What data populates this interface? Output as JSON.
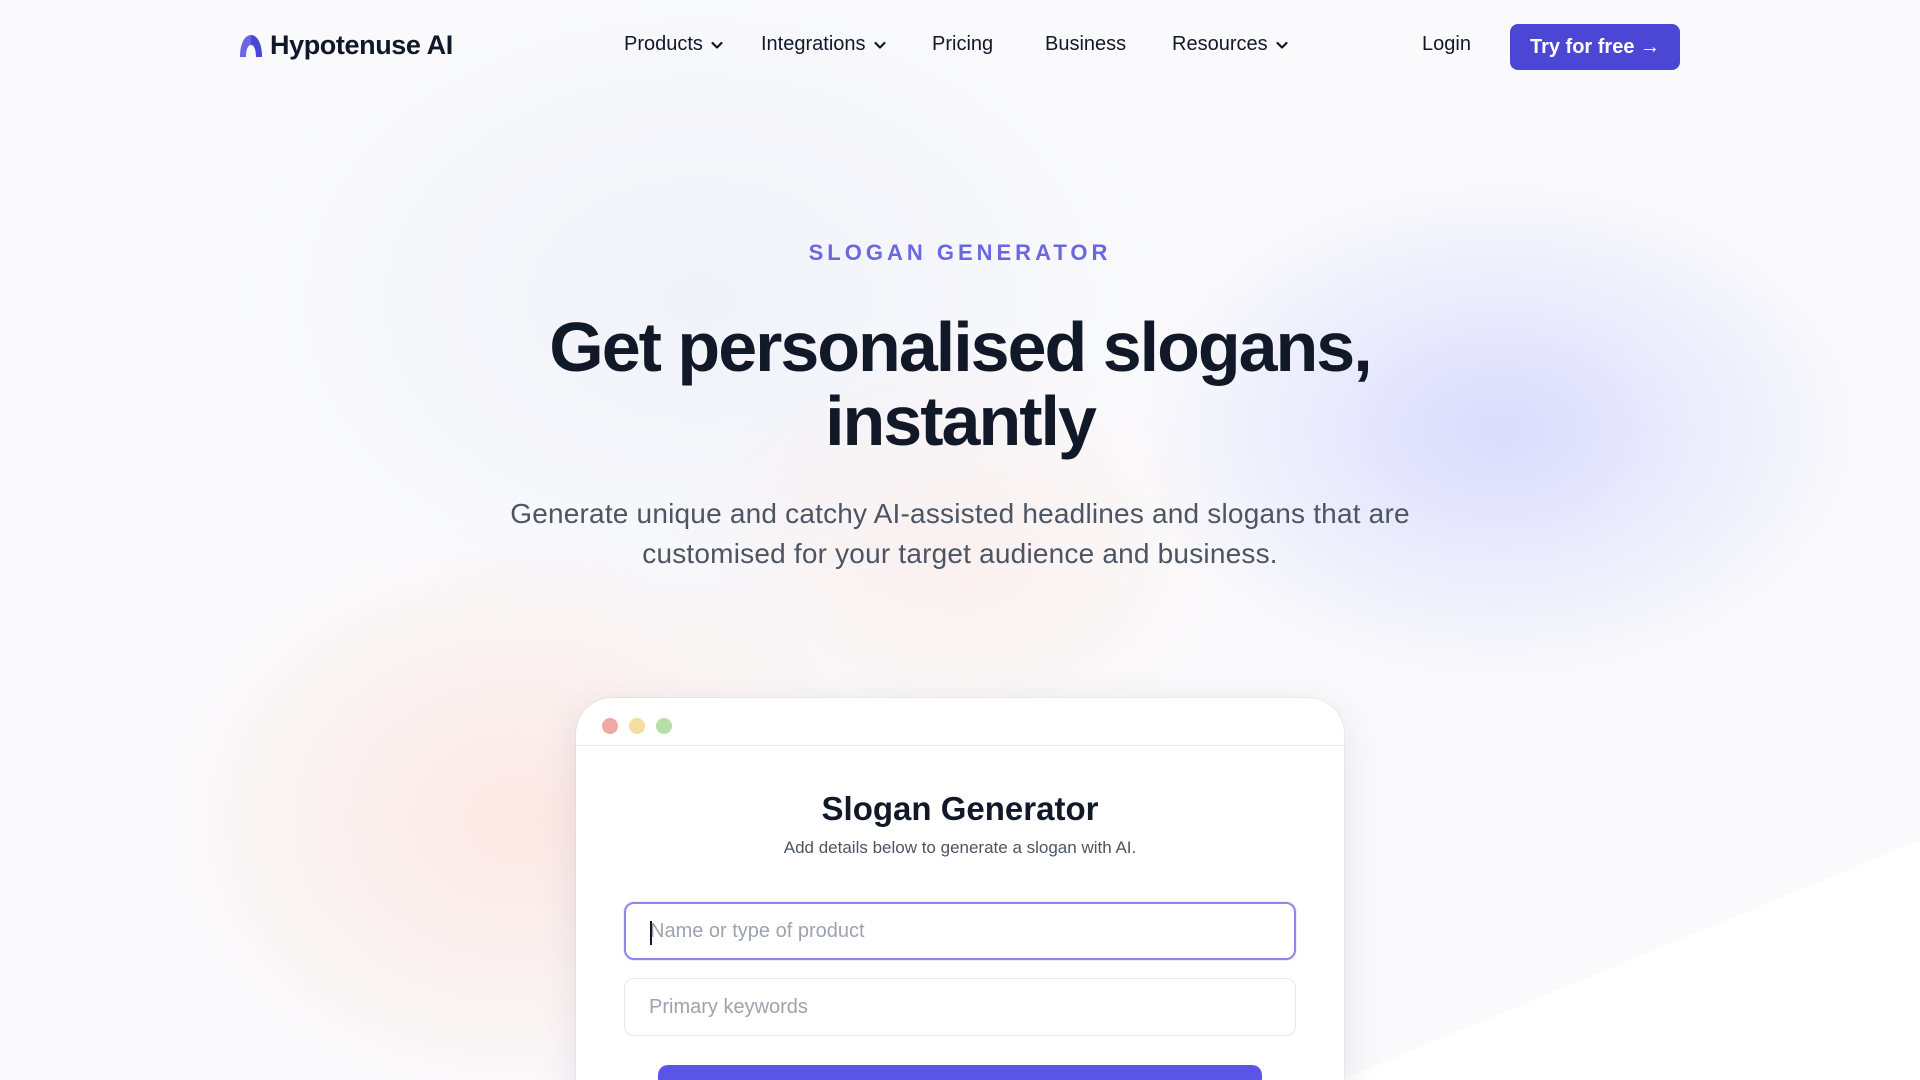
{
  "brand": {
    "name": "Hypotenuse AI",
    "logo_color": "#6a67e0"
  },
  "nav": {
    "items": [
      {
        "label": "Products",
        "has_dropdown": true,
        "icon": "chevron-down-icon"
      },
      {
        "label": "Integrations",
        "has_dropdown": true,
        "icon": "chevron-down-icon"
      },
      {
        "label": "Pricing",
        "has_dropdown": false
      },
      {
        "label": "Business",
        "has_dropdown": false
      },
      {
        "label": "Resources",
        "has_dropdown": true,
        "icon": "chevron-down-icon"
      }
    ],
    "login_label": "Login",
    "cta_label": "Try for free →",
    "cta_color": "#4b47d4"
  },
  "hero": {
    "eyebrow": "SLOGAN GENERATOR",
    "headline": "Get personalised slogans, instantly",
    "subhead": "Generate unique and catchy AI-assisted headlines and slogans that are customised for your target audience and business.",
    "accent_color": "#6a67e0"
  },
  "tool": {
    "window_dots": [
      "#f0a8a4",
      "#f5dca0",
      "#b5dfa4"
    ],
    "title": "Slogan Generator",
    "subtitle": "Add details below to generate a slogan with AI.",
    "product_field": {
      "value": "",
      "placeholder": "Name or type of product"
    },
    "keywords_field": {
      "value": "",
      "placeholder": "Primary keywords"
    },
    "button_color": "#5a55e6"
  }
}
